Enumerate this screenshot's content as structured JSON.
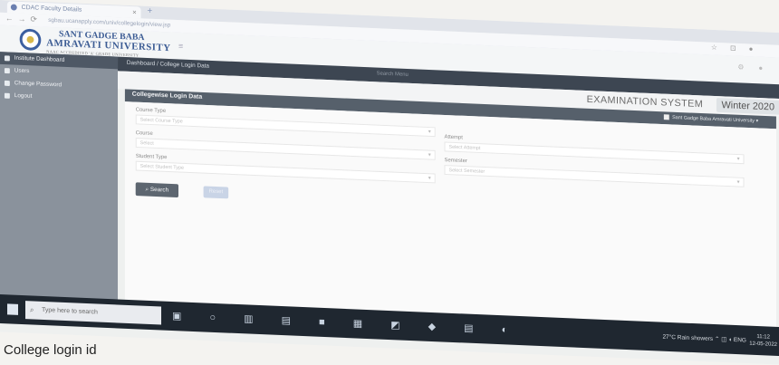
{
  "browser": {
    "tab_title": "CDAC Faculty Details",
    "new_tab": "+",
    "url": "sgbau.ucanapply.com/univ/collegelogin/view.jsp"
  },
  "app": {
    "university_line1": "SANT GADGE BABA",
    "university_line2": "AMRAVATI UNIVERSITY",
    "university_line3": "NAAC ACCREDITED 'A' GRADE UNIVERSITY",
    "menu_toggle": "≡"
  },
  "sidebar": {
    "items": [
      {
        "label": "Institute Dashboard",
        "active": true
      },
      {
        "label": "Users",
        "active": false
      },
      {
        "label": "Change Password",
        "active": false
      },
      {
        "label": "Logout",
        "active": false
      }
    ]
  },
  "content": {
    "breadcrumb": "Dashboard / College Login Data",
    "search_hint": "Search Menu",
    "system_name": "EXAMINATION SYSTEM",
    "session": "Winter 2020",
    "panel_title": "Collegewise Login Data",
    "user_info": "Sant Gadge Baba Amravati University ▾"
  },
  "form": {
    "course_type_label": "Course Type",
    "course_type_placeholder": "Select Course Type",
    "course_label": "Course",
    "course_placeholder": "Select",
    "student_type_label": "Student Type",
    "student_type_placeholder": "Select Student Type",
    "attempt_label": "Attempt",
    "attempt_placeholder": "Select Attempt",
    "semester_label": "Semester",
    "semester_placeholder": "Select Semester",
    "search_button": "Search",
    "reset_button": "Reset"
  },
  "taskbar": {
    "search_placeholder": "Type here to search",
    "weather": "27°C Rain showers",
    "language": "ENG",
    "time": "11:12",
    "date": "12-05-2022"
  },
  "caption": "College login id"
}
